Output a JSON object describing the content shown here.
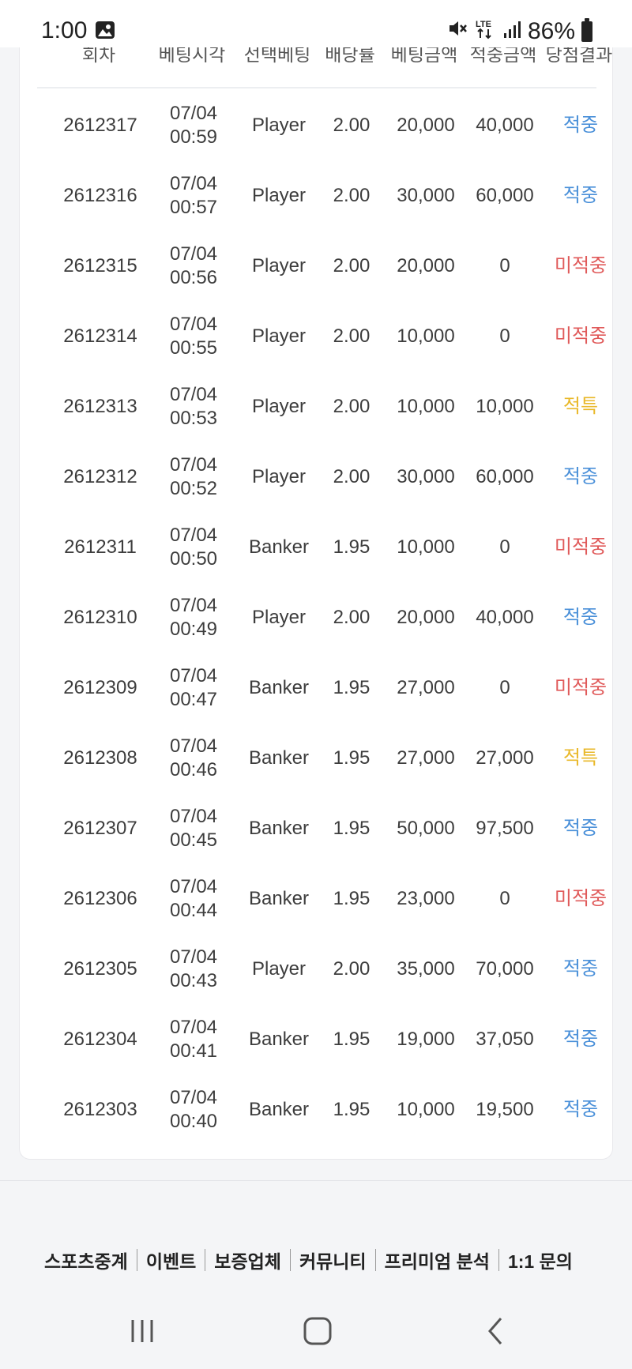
{
  "status_bar": {
    "time": "1:00",
    "network": "LTE",
    "battery": "86%",
    "icons": [
      "gallery-icon",
      "mute-icon",
      "lte-icon",
      "signal-icon",
      "battery-icon"
    ]
  },
  "table": {
    "headers": [
      "회차",
      "베팅시각",
      "선택베팅",
      "배당률",
      "베팅금액",
      "적중금액",
      "당첨결과"
    ],
    "rows": [
      {
        "round": "2612317",
        "date": "07/04",
        "time": "00:59",
        "pick": "Player",
        "odds": "2.00",
        "bet": "20,000",
        "win": "40,000",
        "result": "적중",
        "result_type": "hit"
      },
      {
        "round": "2612316",
        "date": "07/04",
        "time": "00:57",
        "pick": "Player",
        "odds": "2.00",
        "bet": "30,000",
        "win": "60,000",
        "result": "적중",
        "result_type": "hit"
      },
      {
        "round": "2612315",
        "date": "07/04",
        "time": "00:56",
        "pick": "Player",
        "odds": "2.00",
        "bet": "20,000",
        "win": "0",
        "result": "미적중",
        "result_type": "miss"
      },
      {
        "round": "2612314",
        "date": "07/04",
        "time": "00:55",
        "pick": "Player",
        "odds": "2.00",
        "bet": "10,000",
        "win": "0",
        "result": "미적중",
        "result_type": "miss"
      },
      {
        "round": "2612313",
        "date": "07/04",
        "time": "00:53",
        "pick": "Player",
        "odds": "2.00",
        "bet": "10,000",
        "win": "10,000",
        "result": "적특",
        "result_type": "special"
      },
      {
        "round": "2612312",
        "date": "07/04",
        "time": "00:52",
        "pick": "Player",
        "odds": "2.00",
        "bet": "30,000",
        "win": "60,000",
        "result": "적중",
        "result_type": "hit"
      },
      {
        "round": "2612311",
        "date": "07/04",
        "time": "00:50",
        "pick": "Banker",
        "odds": "1.95",
        "bet": "10,000",
        "win": "0",
        "result": "미적중",
        "result_type": "miss"
      },
      {
        "round": "2612310",
        "date": "07/04",
        "time": "00:49",
        "pick": "Player",
        "odds": "2.00",
        "bet": "20,000",
        "win": "40,000",
        "result": "적중",
        "result_type": "hit"
      },
      {
        "round": "2612309",
        "date": "07/04",
        "time": "00:47",
        "pick": "Banker",
        "odds": "1.95",
        "bet": "27,000",
        "win": "0",
        "result": "미적중",
        "result_type": "miss"
      },
      {
        "round": "2612308",
        "date": "07/04",
        "time": "00:46",
        "pick": "Banker",
        "odds": "1.95",
        "bet": "27,000",
        "win": "27,000",
        "result": "적특",
        "result_type": "special"
      },
      {
        "round": "2612307",
        "date": "07/04",
        "time": "00:45",
        "pick": "Banker",
        "odds": "1.95",
        "bet": "50,000",
        "win": "97,500",
        "result": "적중",
        "result_type": "hit"
      },
      {
        "round": "2612306",
        "date": "07/04",
        "time": "00:44",
        "pick": "Banker",
        "odds": "1.95",
        "bet": "23,000",
        "win": "0",
        "result": "미적중",
        "result_type": "miss"
      },
      {
        "round": "2612305",
        "date": "07/04",
        "time": "00:43",
        "pick": "Player",
        "odds": "2.00",
        "bet": "35,000",
        "win": "70,000",
        "result": "적중",
        "result_type": "hit"
      },
      {
        "round": "2612304",
        "date": "07/04",
        "time": "00:41",
        "pick": "Banker",
        "odds": "1.95",
        "bet": "19,000",
        "win": "37,050",
        "result": "적중",
        "result_type": "hit"
      },
      {
        "round": "2612303",
        "date": "07/04",
        "time": "00:40",
        "pick": "Banker",
        "odds": "1.95",
        "bet": "10,000",
        "win": "19,500",
        "result": "적중",
        "result_type": "hit"
      }
    ]
  },
  "result_colors": {
    "hit": "#4a90d9",
    "miss": "#e05a5a",
    "special": "#e9b829"
  },
  "footer": {
    "links": [
      "스포츠중계",
      "이벤트",
      "보증업체",
      "커뮤니티",
      "프리미엄 분석",
      "1:1 문의"
    ]
  },
  "nav_bar": {
    "buttons": [
      "recent-apps-icon",
      "home-icon",
      "back-icon"
    ]
  }
}
